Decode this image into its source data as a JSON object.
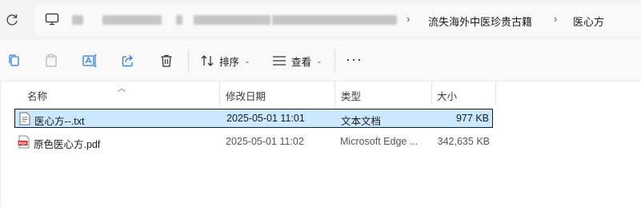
{
  "address_bar": {
    "breadcrumbs": [
      "流失海外中医珍贵古籍",
      "医心方"
    ]
  },
  "toolbar": {
    "copy_icon": "copy-icon",
    "paste_icon": "paste-icon",
    "rename_icon": "rename-icon",
    "share_icon": "share-icon",
    "delete_icon": "delete-icon",
    "sort_label": "排序",
    "view_label": "查看",
    "more_label": "···"
  },
  "columns": {
    "name": "名称",
    "date": "修改日期",
    "type": "类型",
    "size": "大小"
  },
  "files": [
    {
      "name": "医心方--.txt",
      "date": "2025-05-01 11:01",
      "type": "文本文档",
      "size": "977 KB",
      "icon": "txt-file-icon",
      "selected": true
    },
    {
      "name": "原色医心方.pdf",
      "date": "2025-05-01 11:02",
      "type": "Microsoft Edge ...",
      "size": "342,635 KB",
      "icon": "pdf-file-icon",
      "selected": false
    }
  ]
}
